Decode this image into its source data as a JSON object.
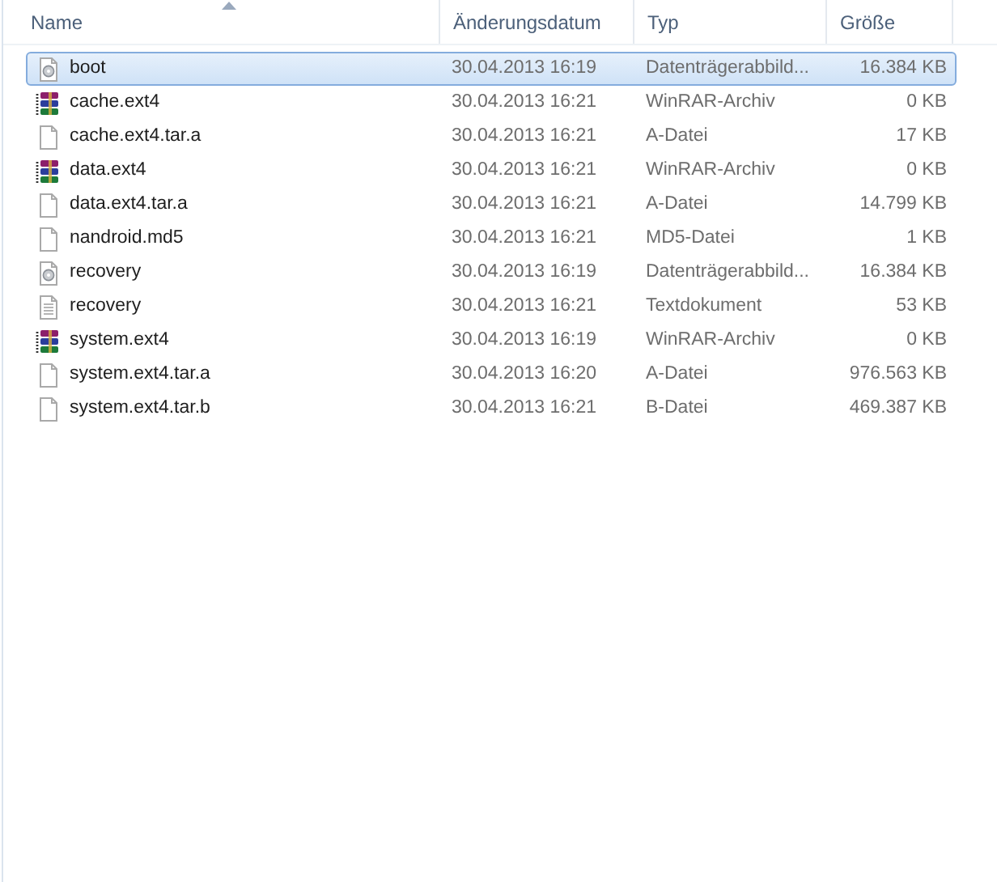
{
  "columns": [
    {
      "label": "Name",
      "sorted": true
    },
    {
      "label": "Änderungsdatum",
      "sorted": false
    },
    {
      "label": "Typ",
      "sorted": false
    },
    {
      "label": "Größe",
      "sorted": false
    }
  ],
  "rows": [
    {
      "kind": "disc",
      "name": "boot",
      "date": "30.04.2013 16:19",
      "type": "Datenträgerabbild...",
      "size": "16.384 KB",
      "selected": true
    },
    {
      "kind": "archive",
      "name": "cache.ext4",
      "date": "30.04.2013 16:21",
      "type": "WinRAR-Archiv",
      "size": "0 KB",
      "selected": false
    },
    {
      "kind": "file",
      "name": "cache.ext4.tar.a",
      "date": "30.04.2013 16:21",
      "type": "A-Datei",
      "size": "17 KB",
      "selected": false
    },
    {
      "kind": "archive",
      "name": "data.ext4",
      "date": "30.04.2013 16:21",
      "type": "WinRAR-Archiv",
      "size": "0 KB",
      "selected": false
    },
    {
      "kind": "file",
      "name": "data.ext4.tar.a",
      "date": "30.04.2013 16:21",
      "type": "A-Datei",
      "size": "14.799 KB",
      "selected": false
    },
    {
      "kind": "file",
      "name": "nandroid.md5",
      "date": "30.04.2013 16:21",
      "type": "MD5-Datei",
      "size": "1 KB",
      "selected": false
    },
    {
      "kind": "disc",
      "name": "recovery",
      "date": "30.04.2013 16:19",
      "type": "Datenträgerabbild...",
      "size": "16.384 KB",
      "selected": false
    },
    {
      "kind": "text",
      "name": "recovery",
      "date": "30.04.2013 16:21",
      "type": "Textdokument",
      "size": "53 KB",
      "selected": false
    },
    {
      "kind": "archive",
      "name": "system.ext4",
      "date": "30.04.2013 16:19",
      "type": "WinRAR-Archiv",
      "size": "0 KB",
      "selected": false
    },
    {
      "kind": "file",
      "name": "system.ext4.tar.a",
      "date": "30.04.2013 16:20",
      "type": "A-Datei",
      "size": "976.563 KB",
      "selected": false
    },
    {
      "kind": "file",
      "name": "system.ext4.tar.b",
      "date": "30.04.2013 16:21",
      "type": "B-Datei",
      "size": "469.387 KB",
      "selected": false
    }
  ]
}
